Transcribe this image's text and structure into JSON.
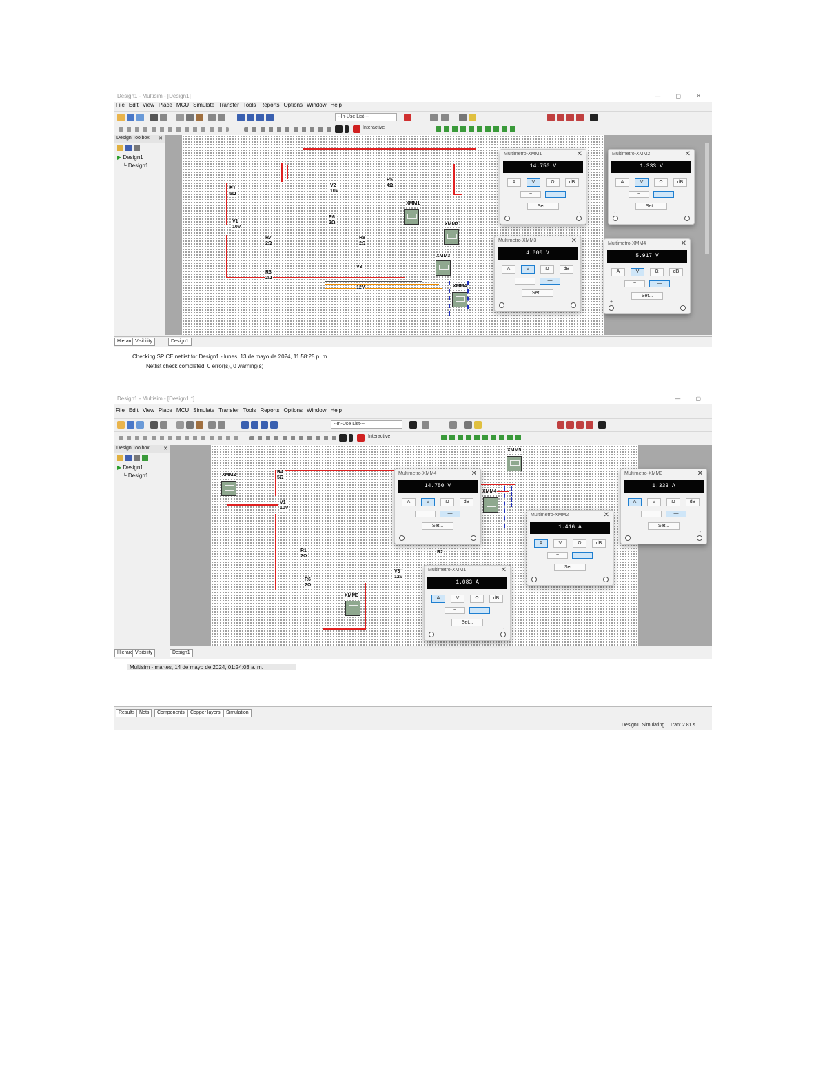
{
  "menu": [
    "File",
    "Edit",
    "View",
    "Place",
    "MCU",
    "Simulate",
    "Transfer",
    "Tools",
    "Reports",
    "Options",
    "Window",
    "Help"
  ],
  "toolbar": {
    "in_use_list": "--In-Use List---",
    "interactive": "Interactive"
  },
  "design_toolbox": {
    "title": "Design Toolbox",
    "root": "Design1",
    "child": "Design1"
  },
  "shot1": {
    "title": "Design1 - Multisim - [Design1]",
    "components": {
      "R1": "R1\n5Ω",
      "V1": "V1\n10V",
      "V2": "V2\n10V",
      "R5": "R5\n4Ω",
      "R6": "R6\n2Ω",
      "R7": "R7\n2Ω",
      "R8": "R8\n2Ω",
      "R3": "R3\n2Ω",
      "V3": "V3",
      "V3v": "12V",
      "XMM1": "XMM1",
      "XMM2": "XMM2",
      "XMM3": "XMM3",
      "XMM4": "XMM4"
    },
    "multimeters": [
      {
        "title": "Multimetro-XMM1",
        "reading": "14.750 V",
        "active_mode": 1
      },
      {
        "title": "Multimetro-XMM2",
        "reading": "1.333 V",
        "active_mode": 1
      },
      {
        "title": "Multimetro-XMM3",
        "reading": "4.000 V",
        "active_mode": 1
      },
      {
        "title": "Multimetro-XMM4",
        "reading": "5.917 V",
        "active_mode": 1
      }
    ],
    "tabs": {
      "toolbox_tab": "Hierarchy",
      "visibility_tab": "Visibility",
      "design_tab": "Design1"
    },
    "output": [
      "Checking SPICE netlist for Design1 - lunes, 13 de mayo de 2024, 11:58:25 p. m.",
      "Netlist check completed: 0 error(s), 0 warning(s)"
    ]
  },
  "shot2": {
    "title": "Design1 - Multisim - [Design1 *]",
    "components": {
      "XMM2": "XMM2",
      "R4": "R4\n5Ω",
      "V1": "V1\n10V",
      "R1": "R1\n2Ω",
      "R6": "R6\n2Ω",
      "R2": "R2",
      "V3": "V3\n12V",
      "XMM3": "XMM3",
      "XMM5": "XMM5",
      "XMM4": "XMM4"
    },
    "multimeters": [
      {
        "title": "Multimetro-XMM4",
        "reading": "14.750 V",
        "active_mode": 1
      },
      {
        "title": "Multimetro-XMM3",
        "reading": "1.333 A",
        "active_mode": 0
      },
      {
        "title": "Multimetro-XMM2",
        "reading": "1.416 A",
        "active_mode": 0
      },
      {
        "title": "Multimetro-XMM1",
        "reading": "1.083 A",
        "active_mode": 0
      }
    ],
    "tabs": {
      "toolbox_tab": "Hierarchy",
      "visibility_tab": "Visibility",
      "design_tab": "Design1"
    },
    "output": [
      "Multisim - martes, 14 de mayo de 2024, 01:24:03 a. m."
    ],
    "bottom_tabs": [
      "Results",
      "Nets",
      "Components",
      "Copper layers",
      "Simulation"
    ],
    "status": "Design1: Simulating...   Tran: 2.81 s"
  },
  "multimeter_labels": {
    "modes": [
      "A",
      "V",
      "Ω",
      "dB"
    ],
    "ac": "~",
    "dc": "—",
    "set": "Set...",
    "minus": "-",
    "plus": "+"
  },
  "colors": {
    "wire_red": "#e02020",
    "wire_orange": "#f08c00",
    "probe_blue": "#2030c0",
    "display_bg": "#050505"
  }
}
